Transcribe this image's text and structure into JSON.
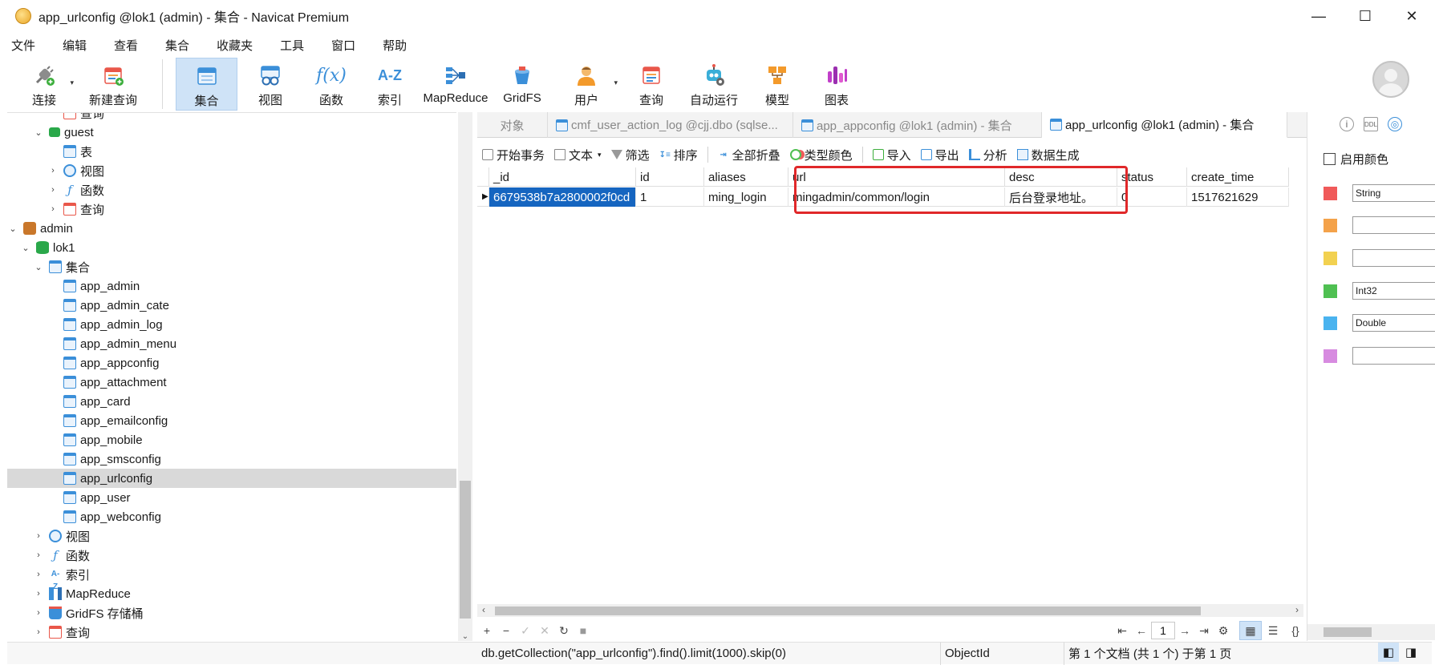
{
  "window": {
    "title": "app_urlconfig @lok1 (admin) - 集合 - Navicat Premium",
    "minimize": "—",
    "maximize": "☐",
    "close": "✕"
  },
  "menu": [
    "文件",
    "编辑",
    "查看",
    "集合",
    "收藏夹",
    "工具",
    "窗口",
    "帮助"
  ],
  "toolbar": {
    "connect": "连接",
    "new_query": "新建查询",
    "collection": "集合",
    "view": "视图",
    "function": "函数",
    "index": "索引",
    "mapreduce": "MapReduce",
    "gridfs": "GridFS",
    "user": "用户",
    "query": "查询",
    "automation": "自动运行",
    "model": "模型",
    "chart": "图表",
    "function_icon_text": "f(x)",
    "index_icon_text": "A-Z"
  },
  "tree": {
    "partial_top": "查询",
    "guest": "guest",
    "guest_table": "表",
    "guest_view": "视图",
    "guest_function": "函数",
    "guest_query": "查询",
    "admin": "admin",
    "lok1": "lok1",
    "collections": "集合",
    "items": [
      "app_admin",
      "app_admin_cate",
      "app_admin_log",
      "app_admin_menu",
      "app_appconfig",
      "app_attachment",
      "app_card",
      "app_emailconfig",
      "app_mobile",
      "app_smsconfig",
      "app_urlconfig",
      "app_user",
      "app_webconfig"
    ],
    "view": "视图",
    "function": "函数",
    "index": "索引",
    "mapreduce": "MapReduce",
    "gridfs": "GridFS 存储桶",
    "query": "查询"
  },
  "tabs": [
    "对象",
    "cmf_user_action_log @cjj.dbo (sqlse...",
    "app_appconfig @lok1 (admin) - 集合",
    "app_urlconfig @lok1 (admin) - 集合"
  ],
  "data_toolbar": {
    "begin_txn": "开始事务",
    "text": "文本",
    "filter": "筛选",
    "sort": "排序",
    "collapse_all": "全部折叠",
    "type_color": "类型颜色",
    "import": "导入",
    "export": "导出",
    "analyze": "分析",
    "data_gen": "数据生成"
  },
  "grid": {
    "columns": [
      "_id",
      "id",
      "aliases",
      "url",
      "desc",
      "status",
      "create_time"
    ],
    "rows": [
      [
        "6679538b7a2800002f0cd",
        "1",
        "ming_login",
        "mingadmin/common/login",
        "后台登录地址。",
        "0",
        "1517621629"
      ]
    ]
  },
  "navigator": {
    "page": "1"
  },
  "status": {
    "query": "db.getCollection(\"app_urlconfig\").find().limit(1000).skip(0)",
    "type": "ObjectId",
    "record": "第 1 个文档 (共 1 个) 于第 1 页"
  },
  "right_panel": {
    "enable_color": "启用颜色",
    "colors": [
      {
        "swatch": "#f05a5a",
        "type": "String"
      },
      {
        "swatch": "#f4a24a",
        "type": ""
      },
      {
        "swatch": "#f2d150",
        "type": ""
      },
      {
        "swatch": "#4fc052",
        "type": "Int32"
      },
      {
        "swatch": "#4ab3ef",
        "type": "Double"
      },
      {
        "swatch": "#d78be0",
        "type": ""
      }
    ]
  },
  "colors": {
    "accent": "#1565c0",
    "highlight": "#e0282a",
    "active_tool": "#cfe3f7"
  }
}
